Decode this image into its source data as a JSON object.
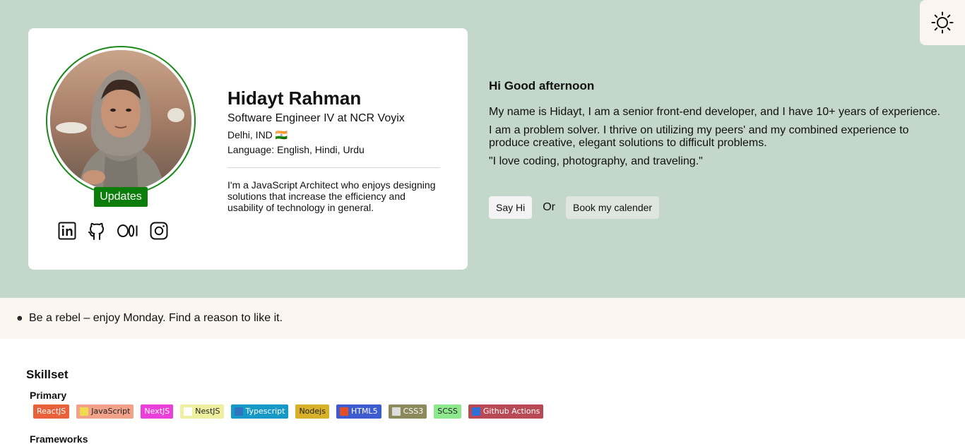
{
  "profile": {
    "name": "Hidayt Rahman",
    "role": " Software Engineer IV at NCR Voyix",
    "location": " Delhi, IND 🇮🇳",
    "languages": " Language: English, Hindi, Urdu",
    "bio": "I'm a JavaScript Architect who enjoys designing solutions that increase the efficiency and usability of technology in general.",
    "updates_label": "Updates",
    "socials": [
      "linkedin-icon",
      "github-icon",
      "medium-icon",
      "instagram-icon"
    ]
  },
  "intro": {
    "greeting": "Hi  Good afternoon ",
    "p1": "My name is Hidayt, I am a senior front-end developer, and I have 10+ years of experience.",
    "p2": "I am a problem solver. I thrive on utilizing my peers' and my combined experience to produce creative, elegant solutions to difficult problems.",
    "p3": "\"I love coding, photography, and traveling.\"",
    "say_hi_label": "Say Hi",
    "or_label": "Or",
    "calendar_label": "Book my calender"
  },
  "quote": {
    "icon": "☻",
    "text": "Be a rebel – enjoy Monday. Find a reason to like it."
  },
  "skills": {
    "title": "Skillset",
    "primary_label": "Primary",
    "frameworks_label": "Frameworks",
    "primary": [
      {
        "label": "ReactJS",
        "bg": "#e8613a",
        "fg": "#ffffff",
        "icon": false
      },
      {
        "label": "JavaScript",
        "bg": "#f2a28a",
        "fg": "#222222",
        "icon": true,
        "icon_color": "#f0db4f"
      },
      {
        "label": "NextJS",
        "bg": "#ea3fd8",
        "fg": "#ffffff",
        "icon": false
      },
      {
        "label": "NestJS",
        "bg": "#eef0a0",
        "fg": "#222222",
        "icon": true,
        "icon_color": "#ffffff"
      },
      {
        "label": "Typescript",
        "bg": "#1799c7",
        "fg": "#ffffff",
        "icon": true,
        "icon_color": "#2f74c0"
      },
      {
        "label": "Nodejs",
        "bg": "#d9b128",
        "fg": "#222222",
        "icon": false
      },
      {
        "label": "HTML5",
        "bg": "#3f5bd0",
        "fg": "#ffffff",
        "icon": true,
        "icon_color": "#e44d26"
      },
      {
        "label": "CSS3",
        "bg": "#8c8a5c",
        "fg": "#ffffff",
        "icon": true,
        "icon_color": "#dddddd"
      },
      {
        "label": "SCSS",
        "bg": "#8ee88e",
        "fg": "#222222",
        "icon": false
      },
      {
        "label": "Github Actions",
        "bg": "#b84a55",
        "fg": "#ffffff",
        "icon": true,
        "icon_color": "#2f6fd6"
      }
    ]
  }
}
